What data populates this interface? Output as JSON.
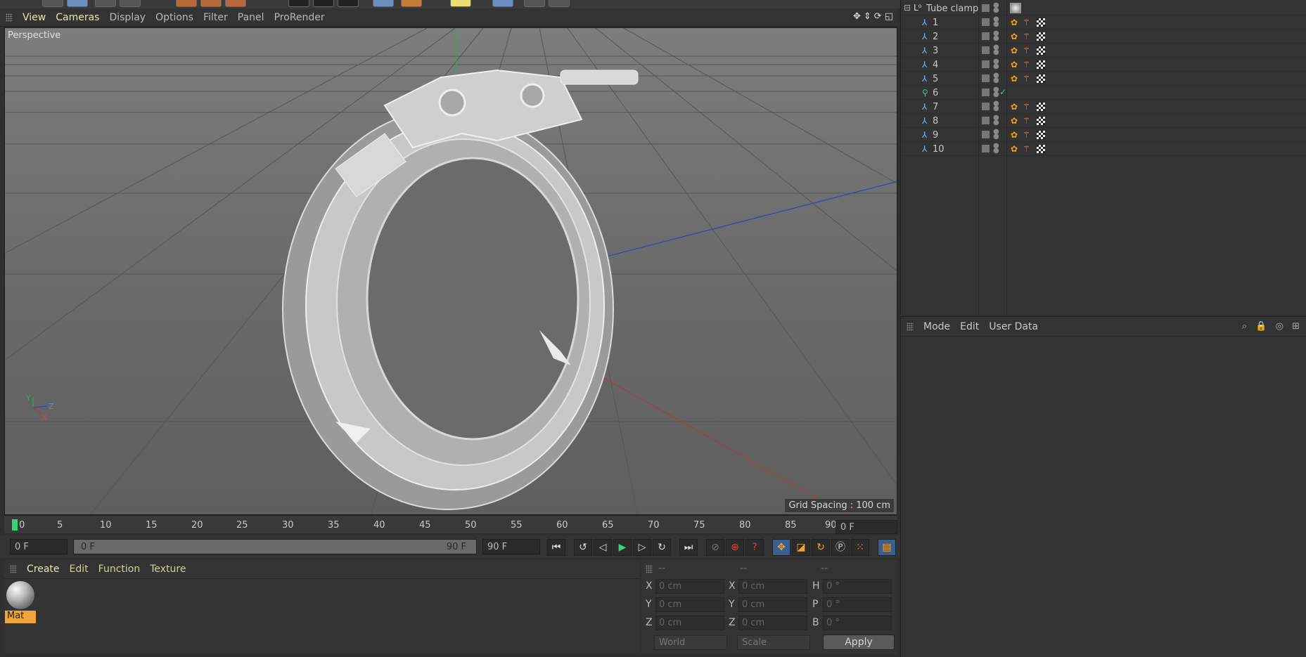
{
  "viewport": {
    "menus": [
      "View",
      "Cameras",
      "Display",
      "Options",
      "Filter",
      "Panel",
      "ProRender"
    ],
    "camera_label": "Perspective",
    "grid_spacing": "Grid Spacing : 100 cm",
    "nav_icons": [
      "move-view-icon",
      "zoom-view-icon",
      "rotate-view-icon",
      "maximize-view-icon"
    ]
  },
  "timeline": {
    "ticks": [
      "0",
      "5",
      "10",
      "15",
      "20",
      "25",
      "30",
      "35",
      "40",
      "45",
      "50",
      "55",
      "60",
      "65",
      "70",
      "75",
      "80",
      "85",
      "90"
    ],
    "current_frame": "0 F"
  },
  "transport": {
    "start_field": "0 F",
    "range_start": "0 F",
    "range_end": "90 F",
    "end_field": "90 F"
  },
  "material_manager": {
    "menus": [
      "Create",
      "Edit",
      "Function",
      "Texture"
    ],
    "material_name": "Mat"
  },
  "coordinates": {
    "headers": [
      "--",
      "--",
      "--"
    ],
    "rows": [
      {
        "pos_label": "X",
        "pos": "0 cm",
        "size_label": "X",
        "size": "0 cm",
        "rot_label": "H",
        "rot": "0 °"
      },
      {
        "pos_label": "Y",
        "pos": "0 cm",
        "size_label": "Y",
        "size": "0 cm",
        "rot_label": "P",
        "rot": "0 °"
      },
      {
        "pos_label": "Z",
        "pos": "0 cm",
        "size_label": "Z",
        "size": "0 cm",
        "rot_label": "B",
        "rot": "0 °"
      }
    ],
    "space": "World",
    "mode": "Scale",
    "apply": "Apply"
  },
  "objects": {
    "root": "Tube clamp",
    "children": [
      "1",
      "2",
      "3",
      "4",
      "5",
      "6",
      "7",
      "8",
      "9",
      "10"
    ]
  },
  "attributes": {
    "menus": [
      "Mode",
      "Edit",
      "User Data"
    ]
  },
  "colors": {
    "accent_orange": "#f0a53a",
    "axis_x": "#c0392b",
    "axis_y": "#27ae60",
    "axis_z": "#2a3fbf"
  }
}
